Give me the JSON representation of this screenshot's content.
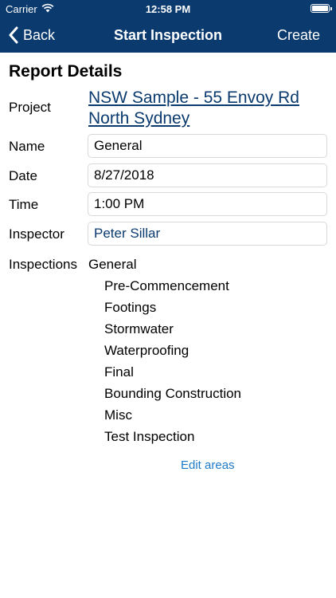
{
  "status_bar": {
    "carrier": "Carrier",
    "time": "12:58 PM"
  },
  "nav": {
    "back_label": "Back",
    "title": "Start Inspection",
    "create_label": "Create"
  },
  "report": {
    "section_title": "Report Details",
    "project_label": "Project",
    "project_value": "NSW Sample - 55 Envoy Rd North Sydney",
    "name_label": "Name",
    "name_value": "General",
    "date_label": "Date",
    "date_value": "8/27/2018",
    "time_label": "Time",
    "time_value": "1:00 PM",
    "inspector_label": "Inspector",
    "inspector_value": "Peter Sillar",
    "inspections_label": "Inspections",
    "group": "General",
    "areas": [
      "Pre-Commencement",
      "Footings",
      "Stormwater",
      "Waterproofing",
      "Final",
      "Bounding Construction",
      "Misc",
      "Test Inspection"
    ],
    "edit_areas_label": "Edit areas"
  },
  "colors": {
    "nav_background": "#0a3a6e",
    "link": "#0a3a6e",
    "edit_link": "#1f7ac6"
  },
  "icons": {
    "back": "chevron-left-icon",
    "wifi": "wifi-icon",
    "battery": "battery-icon"
  }
}
